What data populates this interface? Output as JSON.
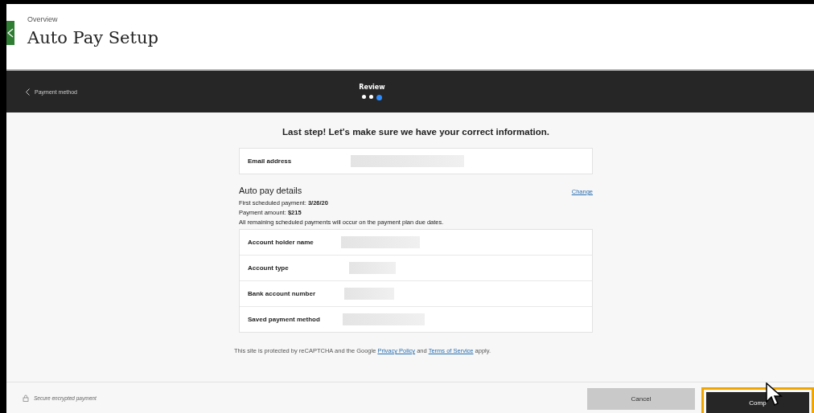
{
  "header": {
    "breadcrumb": "Overview",
    "title": "Auto Pay Setup"
  },
  "step_bar": {
    "back_label": "Payment method",
    "step_title": "Review",
    "steps": [
      {
        "selected": false
      },
      {
        "selected": false
      },
      {
        "selected": true
      }
    ]
  },
  "review": {
    "heading": "Last step! Let's make sure we have your correct information.",
    "email_row": {
      "label": "Email address"
    },
    "details": {
      "title": "Auto pay details",
      "change_link": "Change",
      "lines": [
        "First scheduled payment: **3/26/20**",
        "Payment amount: **$215**",
        "All remaining scheduled payments will occur on the payment plan due dates."
      ],
      "rows": [
        {
          "label": "Account holder name"
        },
        {
          "label": "Account type"
        },
        {
          "label": "Bank account number"
        },
        {
          "label": "Saved payment method"
        }
      ]
    },
    "recaptcha": {
      "before": "This site is protected by reCAPTCHA and the Google",
      "privacy_link": "Privacy Policy",
      "middle": "and",
      "terms_link": "Terms of Service",
      "after": "apply."
    }
  },
  "footer": {
    "secure_note": "Secure encrypted payment",
    "cancel_button": "Cancel",
    "complete_button": "Comp"
  }
}
